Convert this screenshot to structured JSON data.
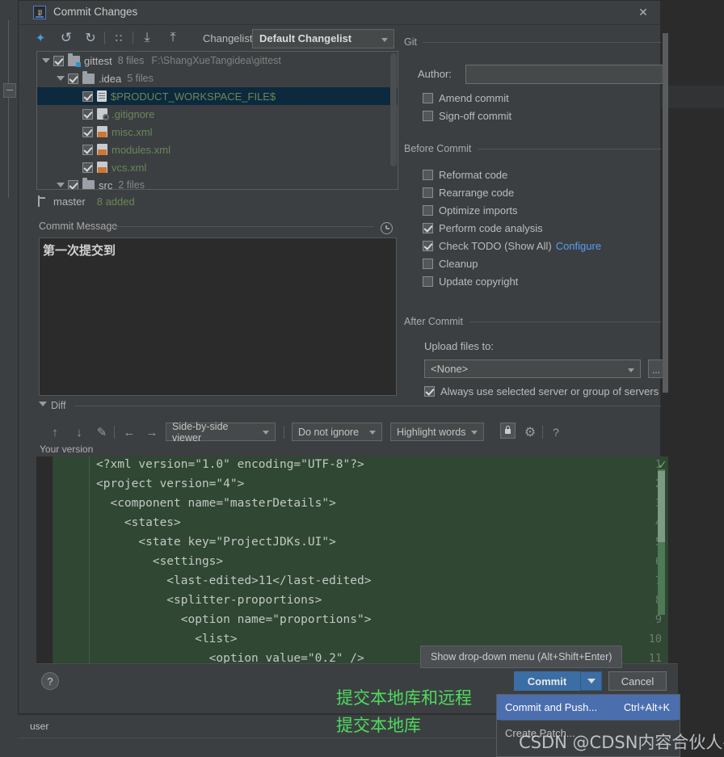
{
  "window": {
    "title": "Commit Changes",
    "icon": "intellij-idea-icon",
    "close_label": "✕"
  },
  "toolbar": {
    "icons": [
      {
        "name": "refresh-changes-icon",
        "glyph": "✦"
      },
      {
        "name": "rollback-icon",
        "glyph": "↺"
      },
      {
        "name": "refresh-icon",
        "glyph": "↻"
      },
      {
        "name": "group-by-icon",
        "glyph": "∷"
      },
      {
        "name": "expand-all-icon",
        "glyph": "⤓"
      },
      {
        "name": "collapse-all-icon",
        "glyph": "⤒"
      }
    ],
    "changelist_label": "Changelist:",
    "changelist_value": "Default Changelist"
  },
  "file_tree": {
    "rows": [
      {
        "indent": 0,
        "twisty": true,
        "checked": true,
        "icon": "folder-vcs-icon",
        "name": "gittest",
        "is_dir": true,
        "meta": "8 files",
        "path": "F:\\ShangXueTangidea\\gittest",
        "selected": false
      },
      {
        "indent": 1,
        "twisty": true,
        "checked": true,
        "icon": "folder-icon",
        "name": ".idea",
        "is_dir": true,
        "meta": "5 files",
        "path": "",
        "selected": false
      },
      {
        "indent": 2,
        "twisty": false,
        "checked": true,
        "icon": "file-icon",
        "name": "$PRODUCT_WORKSPACE_FILE$",
        "is_dir": false,
        "meta": "",
        "path": "",
        "selected": true
      },
      {
        "indent": 2,
        "twisty": false,
        "checked": true,
        "icon": "gitignore-icon",
        "name": ".gitignore",
        "is_dir": false,
        "meta": "",
        "path": "",
        "selected": false
      },
      {
        "indent": 2,
        "twisty": false,
        "checked": true,
        "icon": "xml-file-icon",
        "name": "misc.xml",
        "is_dir": false,
        "meta": "",
        "path": "",
        "selected": false
      },
      {
        "indent": 2,
        "twisty": false,
        "checked": true,
        "icon": "xml-file-icon",
        "name": "modules.xml",
        "is_dir": false,
        "meta": "",
        "path": "",
        "selected": false
      },
      {
        "indent": 2,
        "twisty": false,
        "checked": true,
        "icon": "xml-file-icon",
        "name": "vcs.xml",
        "is_dir": false,
        "meta": "",
        "path": "",
        "selected": false
      },
      {
        "indent": 1,
        "twisty": true,
        "checked": true,
        "icon": "folder-icon",
        "name": "src",
        "is_dir": true,
        "meta": "2 files",
        "path": "",
        "selected": false
      }
    ]
  },
  "branch_status": {
    "branch": "master",
    "added": "8 added"
  },
  "commit_message": {
    "section_title": "Commit Message",
    "value": "第一次提交到",
    "history_icon": "clock-history-icon"
  },
  "git_section": {
    "title": "Git",
    "author_label": "Author:",
    "author_value": "",
    "options": [
      {
        "label": "Amend commit",
        "checked": false
      },
      {
        "label": "Sign-off commit",
        "checked": false
      }
    ]
  },
  "before_commit": {
    "title": "Before Commit",
    "options": [
      {
        "label": "Reformat code",
        "checked": false,
        "link": ""
      },
      {
        "label": "Rearrange code",
        "checked": false,
        "link": ""
      },
      {
        "label": "Optimize imports",
        "checked": false,
        "link": ""
      },
      {
        "label": "Perform code analysis",
        "checked": true,
        "link": ""
      },
      {
        "label": "Check TODO (Show All)",
        "checked": true,
        "link": "Configure"
      },
      {
        "label": "Cleanup",
        "checked": false,
        "link": ""
      },
      {
        "label": "Update copyright",
        "checked": false,
        "link": ""
      }
    ]
  },
  "after_commit": {
    "title": "After Commit",
    "upload_label": "Upload files to:",
    "upload_value": "<None>",
    "ellipsis_label": "...",
    "always_use_label": "Always use selected server or group of servers",
    "always_use_checked": true
  },
  "diff": {
    "section_title": "Diff",
    "icons": [
      {
        "name": "previous-difference-icon",
        "glyph": "↑"
      },
      {
        "name": "next-difference-icon",
        "glyph": "↓"
      },
      {
        "name": "edit-source-icon",
        "glyph": "✎"
      },
      {
        "name": "accept-left-icon",
        "glyph": "←"
      },
      {
        "name": "accept-right-icon",
        "glyph": "→"
      },
      {
        "name": "settings-gear-icon",
        "glyph": "⚙"
      },
      {
        "name": "help-question-icon",
        "glyph": "?"
      }
    ],
    "viewer_mode": "Side-by-side viewer",
    "ignore_mode": "Do not ignore",
    "highlight_mode": "Highlight words",
    "lock_icon": "lock-icon",
    "your_version_label": "Your version",
    "code_lines": [
      {
        "number": "1",
        "text": "<?xml version=\"1.0\" encoding=\"UTF-8\"?>"
      },
      {
        "number": "2",
        "text": "<project version=\"4\">"
      },
      {
        "number": "3",
        "text": "  <component name=\"masterDetails\">"
      },
      {
        "number": "4",
        "text": "    <states>"
      },
      {
        "number": "5",
        "text": "      <state key=\"ProjectJDKs.UI\">"
      },
      {
        "number": "6",
        "text": "        <settings>"
      },
      {
        "number": "7",
        "text": "          <last-edited>11</last-edited>"
      },
      {
        "number": "8",
        "text": "          <splitter-proportions>"
      },
      {
        "number": "9",
        "text": "            <option name=\"proportions\">"
      },
      {
        "number": "10",
        "text": "              <list>"
      },
      {
        "number": "11",
        "text": "                <option value=\"0.2\" />"
      }
    ]
  },
  "buttons": {
    "help": "?",
    "commit": "Commit",
    "cancel": "Cancel",
    "dropdown_arrow_icon": "chevron-down-icon"
  },
  "tooltip": {
    "text": "Show drop-down menu (Alt+Shift+Enter)"
  },
  "dropdown_menu": {
    "items": [
      {
        "label": "Commit and Push...",
        "shortcut": "Ctrl+Alt+K",
        "selected": true
      },
      {
        "label": "Create Patch...",
        "shortcut": "",
        "selected": false
      }
    ]
  },
  "annotations": [
    {
      "text": "提交本地库和远程",
      "color": "#4ddb5e"
    },
    {
      "text": "提交本地库",
      "color": "#4ddb5e"
    }
  ],
  "status_bar": {
    "user": "user"
  },
  "watermark": {
    "text": "CSDN @CDSN内容合伙人-秃头"
  }
}
